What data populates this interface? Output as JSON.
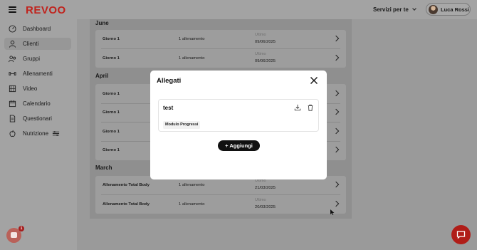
{
  "app": {
    "logo": "REVOO"
  },
  "header": {
    "services_label": "Servizi per te",
    "user_name": "Luca Rossi"
  },
  "sidebar": {
    "items": [
      {
        "label": "Dashboard",
        "icon": "gauge-icon"
      },
      {
        "label": "Clienti",
        "icon": "user-icon",
        "active": true
      },
      {
        "label": "Gruppi",
        "icon": "group-icon"
      },
      {
        "label": "Allenamenti",
        "icon": "dumbbell-icon"
      },
      {
        "label": "Video",
        "icon": "film-icon"
      },
      {
        "label": "Calendario",
        "icon": "calendar-icon"
      },
      {
        "label": "Questionari",
        "icon": "document-icon"
      },
      {
        "label": "Nutrizione",
        "icon": "apple-icon",
        "extra_icon": "settings-sliders-icon"
      }
    ]
  },
  "sections": [
    {
      "title": "June",
      "rows": [
        {
          "name": "Giorno 1",
          "count": "1 allenamento",
          "ultimo": "Ultimo",
          "date": "09/06/2025"
        },
        {
          "name": "Giorno 1",
          "count": "1 allenamento",
          "ultimo": "Ultimo",
          "date": "09/06/2025"
        }
      ]
    },
    {
      "title": "April",
      "rows": [
        {
          "name": "Giorno 1"
        },
        {
          "name": "Giorno 1"
        },
        {
          "name": "Giorno 1"
        },
        {
          "name": "Giorno 1"
        }
      ]
    },
    {
      "title": "March",
      "rows": [
        {
          "name": "Allenamento Total Body",
          "count": "1 allenamento",
          "ultimo": "Ultimo",
          "date": "21/03/2025"
        },
        {
          "name": "Allenamento Total Body",
          "count": "1 allenamento",
          "ultimo": "Ultimo",
          "date": "20/03/2025"
        }
      ]
    }
  ],
  "modal": {
    "title": "Allegati",
    "attachment": {
      "name": "test",
      "tag": "Modulo Progressi"
    },
    "add_label": "+ Aggiungi"
  },
  "widgets": {
    "intercom_badge": "1"
  },
  "colors": {
    "brand": "#c0231d",
    "chat_button": "#b01d18",
    "overlay": "#9a9a9a"
  }
}
